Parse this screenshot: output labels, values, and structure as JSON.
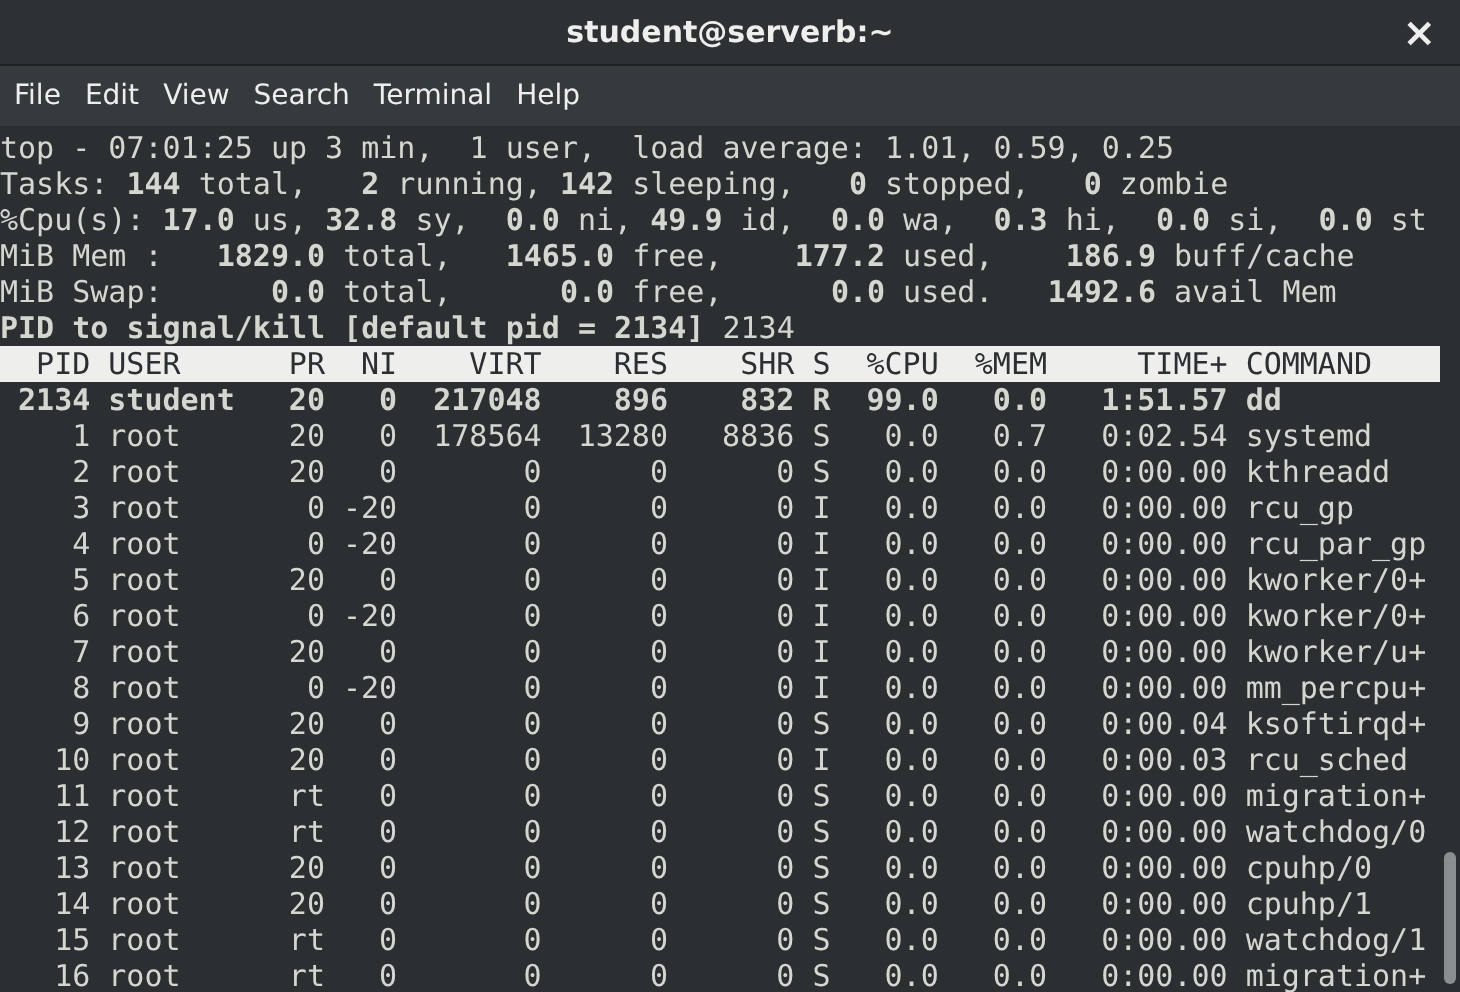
{
  "window": {
    "title": "student@serverb:~",
    "close": "×"
  },
  "menu": [
    "File",
    "Edit",
    "View",
    "Search",
    "Terminal",
    "Help"
  ],
  "summary": [
    "top - 07:01:25 up 3 min,  1 user,  load average: 1.01, 0.59, 0.25",
    "Tasks: **144** total,   **2** running, **142** sleeping,   **0** stopped,   **0** zombie",
    "%Cpu(s): **17.0** us, **32.8** sy,  **0.0** ni, **49.9** id,  **0.0** wa,  **0.3** hi,  **0.0** si,  **0.0** st",
    "MiB Mem :   **1829.0** total,   **1465.0** free,    **177.2** used,    **186.9** buff/cache",
    "MiB Swap:      **0.0** total,      **0.0** free,      **0.0** used.   **1492.6** avail Mem"
  ],
  "prompt": {
    "label": "PID to signal/kill [default pid = 2134]",
    "value": "2134"
  },
  "table": {
    "columns": [
      "PID",
      "USER",
      "PR",
      "NI",
      "VIRT",
      "RES",
      "SHR",
      "S",
      "%CPU",
      "%MEM",
      "TIME+",
      "COMMAND"
    ],
    "rows": [
      {
        "bold": true,
        "cells": [
          "2134",
          "student",
          "20",
          "0",
          "217048",
          "896",
          "832",
          "R",
          "99.0",
          "0.0",
          "1:51.57",
          "dd"
        ]
      },
      {
        "bold": false,
        "cells": [
          "1",
          "root",
          "20",
          "0",
          "178564",
          "13280",
          "8836",
          "S",
          "0.0",
          "0.7",
          "0:02.54",
          "systemd"
        ]
      },
      {
        "bold": false,
        "cells": [
          "2",
          "root",
          "20",
          "0",
          "0",
          "0",
          "0",
          "S",
          "0.0",
          "0.0",
          "0:00.00",
          "kthreadd"
        ]
      },
      {
        "bold": false,
        "cells": [
          "3",
          "root",
          "0",
          "-20",
          "0",
          "0",
          "0",
          "I",
          "0.0",
          "0.0",
          "0:00.00",
          "rcu_gp"
        ]
      },
      {
        "bold": false,
        "cells": [
          "4",
          "root",
          "0",
          "-20",
          "0",
          "0",
          "0",
          "I",
          "0.0",
          "0.0",
          "0:00.00",
          "rcu_par_gp"
        ]
      },
      {
        "bold": false,
        "cells": [
          "5",
          "root",
          "20",
          "0",
          "0",
          "0",
          "0",
          "I",
          "0.0",
          "0.0",
          "0:00.00",
          "kworker/0+"
        ]
      },
      {
        "bold": false,
        "cells": [
          "6",
          "root",
          "0",
          "-20",
          "0",
          "0",
          "0",
          "I",
          "0.0",
          "0.0",
          "0:00.00",
          "kworker/0+"
        ]
      },
      {
        "bold": false,
        "cells": [
          "7",
          "root",
          "20",
          "0",
          "0",
          "0",
          "0",
          "I",
          "0.0",
          "0.0",
          "0:00.00",
          "kworker/u+"
        ]
      },
      {
        "bold": false,
        "cells": [
          "8",
          "root",
          "0",
          "-20",
          "0",
          "0",
          "0",
          "I",
          "0.0",
          "0.0",
          "0:00.00",
          "mm_percpu+"
        ]
      },
      {
        "bold": false,
        "cells": [
          "9",
          "root",
          "20",
          "0",
          "0",
          "0",
          "0",
          "S",
          "0.0",
          "0.0",
          "0:00.04",
          "ksoftirqd+"
        ]
      },
      {
        "bold": false,
        "cells": [
          "10",
          "root",
          "20",
          "0",
          "0",
          "0",
          "0",
          "I",
          "0.0",
          "0.0",
          "0:00.03",
          "rcu_sched"
        ]
      },
      {
        "bold": false,
        "cells": [
          "11",
          "root",
          "rt",
          "0",
          "0",
          "0",
          "0",
          "S",
          "0.0",
          "0.0",
          "0:00.00",
          "migration+"
        ]
      },
      {
        "bold": false,
        "cells": [
          "12",
          "root",
          "rt",
          "0",
          "0",
          "0",
          "0",
          "S",
          "0.0",
          "0.0",
          "0:00.00",
          "watchdog/0"
        ]
      },
      {
        "bold": false,
        "cells": [
          "13",
          "root",
          "20",
          "0",
          "0",
          "0",
          "0",
          "S",
          "0.0",
          "0.0",
          "0:00.00",
          "cpuhp/0"
        ]
      },
      {
        "bold": false,
        "cells": [
          "14",
          "root",
          "20",
          "0",
          "0",
          "0",
          "0",
          "S",
          "0.0",
          "0.0",
          "0:00.00",
          "cpuhp/1"
        ]
      },
      {
        "bold": false,
        "cells": [
          "15",
          "root",
          "rt",
          "0",
          "0",
          "0",
          "0",
          "S",
          "0.0",
          "0.0",
          "0:00.00",
          "watchdog/1"
        ]
      },
      {
        "bold": false,
        "cells": [
          "16",
          "root",
          "rt",
          "0",
          "0",
          "0",
          "0",
          "S",
          "0.0",
          "0.0",
          "0:00.00",
          "migration+"
        ]
      }
    ]
  }
}
